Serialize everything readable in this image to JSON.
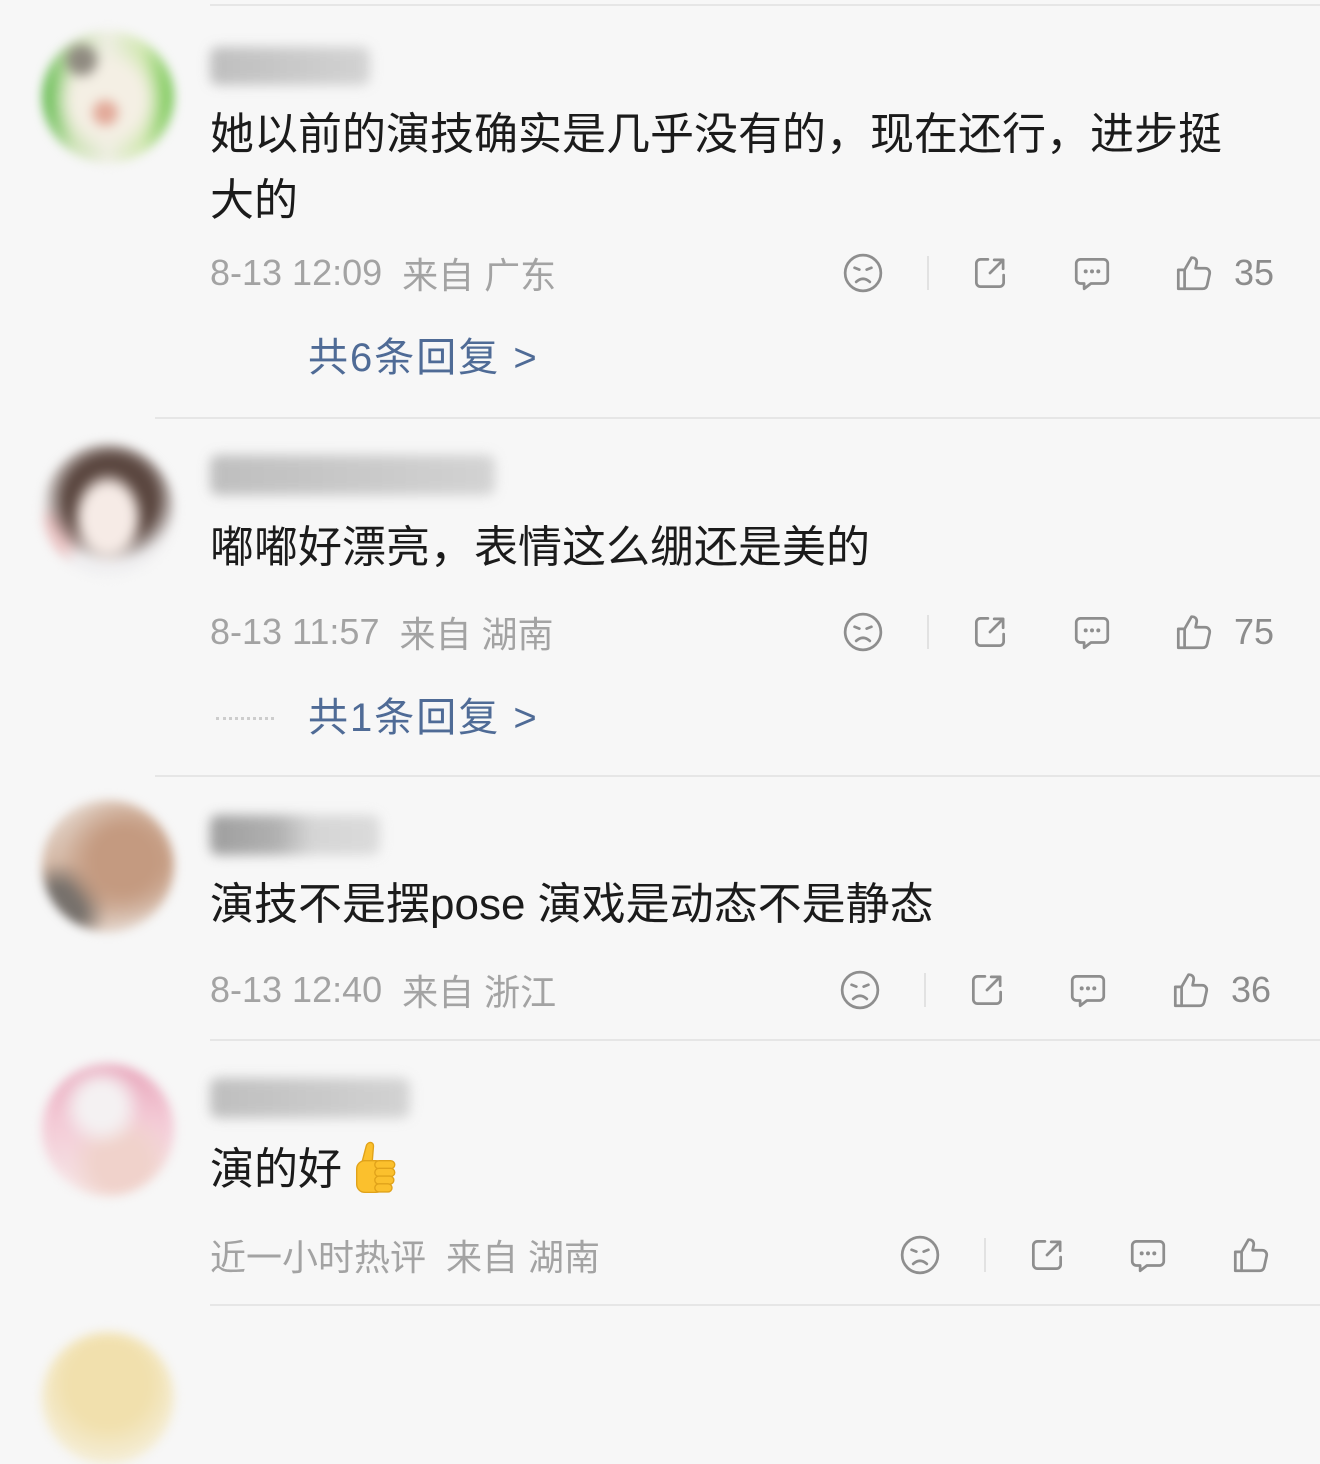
{
  "colors": {
    "background": "#f7f7f7",
    "text": "#1b1b1b",
    "meta": "#a3a3a3",
    "icon": "#8e8e8e",
    "reply_link": "#4f6b96",
    "divider": "#e6e6e6",
    "emoji": "#fbc02d"
  },
  "icons": {
    "dislike": "sad-face-icon",
    "share": "share-icon",
    "comment": "comment-icon",
    "like": "thumbs-up-icon"
  },
  "comments": [
    {
      "text": "她以前的演技确实是几乎没有的，现在还行，进步挺大的",
      "time": "8-13 12:09",
      "location": "来自 广东",
      "likes": "35",
      "replies": "共6条回复 >"
    },
    {
      "text": "嘟嘟好漂亮，表情这么绷还是美的",
      "time": "8-13 11:57",
      "location": "来自 湖南",
      "likes": "75",
      "replies": "共1条回复 >"
    },
    {
      "text": "演技不是摆pose 演戏是动态不是静态",
      "time": "8-13 12:40",
      "location": "来自 浙江",
      "likes": "36"
    },
    {
      "text": "演的好",
      "emoji": "thumbs-up-emoji",
      "time": "近一小时热评",
      "location": "来自 湖南"
    }
  ]
}
